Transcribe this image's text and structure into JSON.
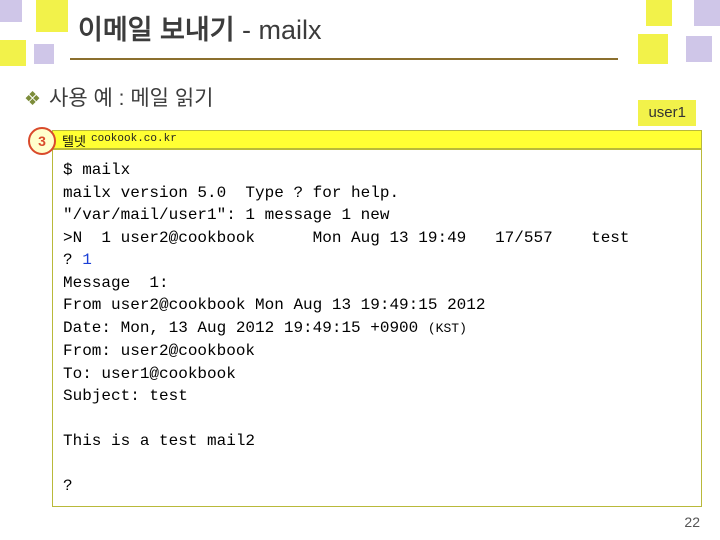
{
  "slide": {
    "title_main": "이메일 보내기",
    "title_sub": " - mailx",
    "subtitle": "사용 예 : 메일 읽기",
    "bullet_glyph": "❖",
    "user_tag": "user1",
    "step_number": "3",
    "page_number": "22"
  },
  "terminal": {
    "header_label": "텔넷",
    "header_host": "cookook.co.kr",
    "lines": [
      {
        "text": "$ mailx",
        "style": "normal"
      },
      {
        "text": "mailx version 5.0  Type ? for help.",
        "style": "normal"
      },
      {
        "text": "\"/var/mail/user1\": 1 message 1 new",
        "style": "normal"
      },
      {
        "text": ">N  1 user2@cookbook      Mon Aug 13 19:49   17/557    test",
        "style": "normal"
      },
      {
        "text": "? 1",
        "style": "prompt-blue"
      },
      {
        "text": "Message  1:",
        "style": "normal"
      },
      {
        "text": "From user2@cookbook Mon Aug 13 19:49:15 2012",
        "style": "normal"
      },
      {
        "text": "Date: Mon, 13 Aug 2012 19:49:15 +0900 (KST)",
        "style": "date"
      },
      {
        "text": "From: user2@cookbook",
        "style": "normal"
      },
      {
        "text": "To: user1@cookbook",
        "style": "normal"
      },
      {
        "text": "Subject: test",
        "style": "normal"
      },
      {
        "text": "",
        "style": "blank"
      },
      {
        "text": "This is a test mail2",
        "style": "normal"
      },
      {
        "text": "",
        "style": "blank"
      },
      {
        "text": "?",
        "style": "normal"
      }
    ],
    "line4_prompt": "? ",
    "line4_value": "1",
    "line_date_main": "Date: Mon, 13 Aug 2012 19:49:15 +0900 ",
    "line_date_tz": "(KST)"
  }
}
